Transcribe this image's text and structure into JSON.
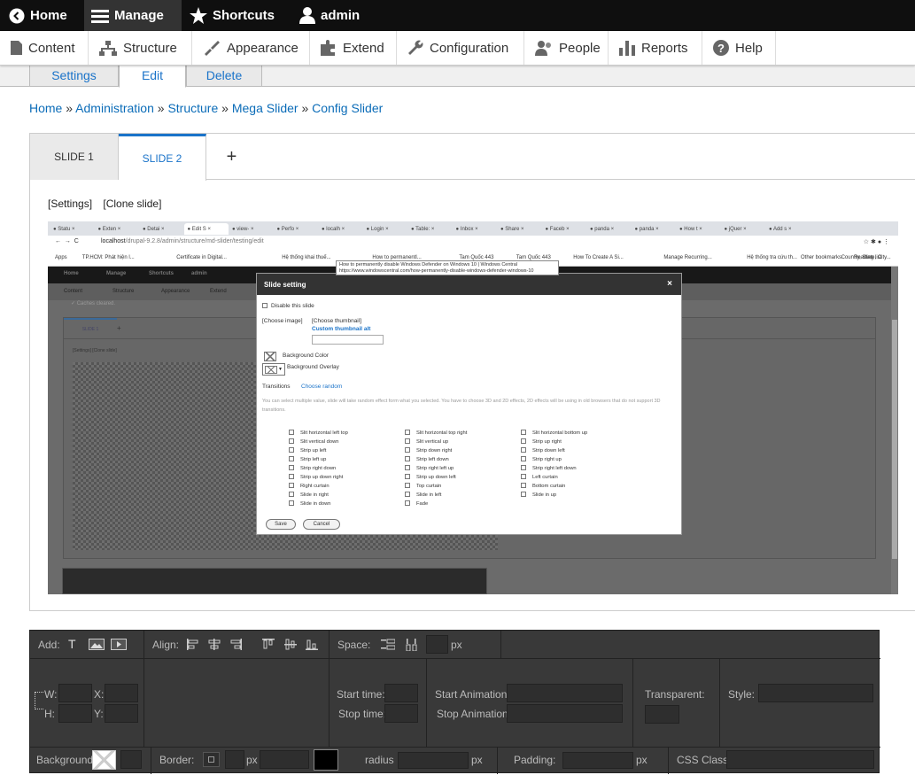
{
  "toolbar": {
    "home": "Home",
    "manage": "Manage",
    "shortcuts": "Shortcuts",
    "user": "admin"
  },
  "tray": {
    "content": "Content",
    "structure": "Structure",
    "appearance": "Appearance",
    "extend": "Extend",
    "configuration": "Configuration",
    "people": "People",
    "reports": "Reports",
    "help": "Help"
  },
  "page_tabs": {
    "settings": "Settings",
    "edit": "Edit",
    "delete": "Delete"
  },
  "breadcrumb": {
    "home": "Home",
    "administration": "Administration",
    "structure": "Structure",
    "mega_slider": "Mega Slider",
    "config_slider": "Config Slider",
    "sep": "»"
  },
  "slides": {
    "slide1": "SLIDE 1",
    "slide2": "SLIDE 2",
    "add": "+"
  },
  "slide_links": {
    "settings": "[Settings]",
    "clone": "[Clone slide]"
  },
  "screenshot": {
    "tabs": [
      "Statu",
      "Exten",
      "Detai",
      "Edit S",
      "view-",
      "Perfo",
      "localh",
      "Login",
      "Table:",
      "Inbox",
      "Share",
      "Faceb",
      "panda",
      "panda",
      "How t",
      "jQuer",
      "Add s"
    ],
    "url_prefix": "localhost",
    "url_rest": "/drupal-9.2.8/admin/structure/md-slider/testing/edit",
    "bookmarks": [
      "Apps",
      "TP.HCM: Phát hiện l...",
      "Certificate in Digital...",
      "Hệ thống khai thuế...",
      "How to permanentl...",
      "Tam Quốc 443",
      "Tam Quốc 443",
      "How To Create A Si...",
      "Manage Recurring...",
      "Hệ thống tra cứu th...",
      "Country, State, City..."
    ],
    "bookmarks_right": [
      "Other bookmarks",
      "Reading list"
    ],
    "tooltip_title": "How to permanently disable Windows Defender on Windows 10 | Windows Central",
    "tooltip_url": "https://www.windowscentral.com/how-permanently-disable-windows-defender-windows-10",
    "mini_toolbar": [
      "Home",
      "Manage",
      "Shortcuts",
      "admin"
    ],
    "mini_tray": [
      "Content",
      "Structure",
      "Appearance",
      "Extend"
    ],
    "caches": "Caches cleared.",
    "mini_slide": "SLIDE 1",
    "mini_links": "[Settings]  [Clone slide]"
  },
  "modal": {
    "title": "Slide setting",
    "close": "×",
    "disable": "Disable this slide",
    "choose_image": "[Choose image]",
    "choose_thumb": "[Choose thumbnail]",
    "custom_thumb_alt": "Custom thumbnail alt",
    "bg_color": "Background Color",
    "bg_overlay": "Background Overlay",
    "transitions": "Transitions",
    "choose_random": "Choose random",
    "help": "You can select multiple value, slide will take random effect form what you selected. You have to choose 3D and 2D effects, 2D effects will be using in old browsers that do not support 3D transitions.",
    "col1": [
      "Slit horizontal left top",
      "Slit vertical down",
      "Strip up left",
      "Strip left up",
      "Strip right down",
      "Strip up down right",
      "Right curtain",
      "Slide in right",
      "Slide in down"
    ],
    "col2": [
      "Slit horizontal top right",
      "Slit vertical up",
      "Strip down right",
      "Strip left down",
      "Strip right left up",
      "Strip up down left",
      "Top curtain",
      "Slide in left",
      "Fade"
    ],
    "col3": [
      "Slit horizontal bottom up",
      "Strip up right",
      "Strip down left",
      "Strip right up",
      "Strip right left down",
      "Left curtain",
      "Bottom curtain",
      "Slide in up"
    ],
    "save": "Save",
    "cancel": "Cancel"
  },
  "editor": {
    "add": "Add:",
    "align": "Align:",
    "space": "Space:",
    "px": "px",
    "w": "W:",
    "h": "H:",
    "x": "X:",
    "y": "Y:",
    "start_time": "Start time:",
    "stop_time": "Stop time:",
    "start_anim": "Start Animation:",
    "stop_anim": "Stop Animation:",
    "transparent": "Transparent:",
    "style": "Style:",
    "background": "Background:",
    "border": "Border:",
    "radius": "radius",
    "padding": "Padding:",
    "css_class": "CSS Class",
    "text_icon": "T"
  }
}
